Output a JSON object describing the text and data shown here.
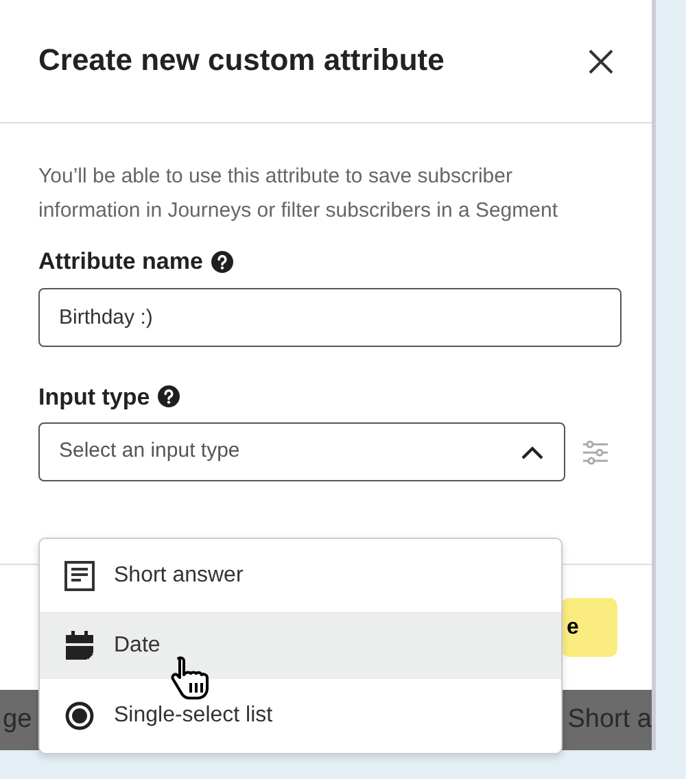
{
  "dialog": {
    "title": "Create new custom attribute",
    "description": "You’ll be able to use this attribute to save subscriber information in Journeys or filter subscribers in a Segment"
  },
  "fields": [
    {
      "kind": "text",
      "label": "Attribute name",
      "value": "Birthday :)"
    },
    {
      "kind": "select",
      "label": "Input type",
      "placeholder": "Select an input type",
      "expanded": true
    }
  ],
  "options": [
    {
      "kind": "text",
      "label": "Short answer",
      "selected": false
    },
    {
      "kind": "date",
      "label": "Date",
      "selected": true
    },
    {
      "kind": "radio",
      "label": "Single-select list",
      "selected": false
    }
  ],
  "footer_button": {
    "label": "e"
  },
  "background_texts": [
    "ge",
    "Short a"
  ]
}
